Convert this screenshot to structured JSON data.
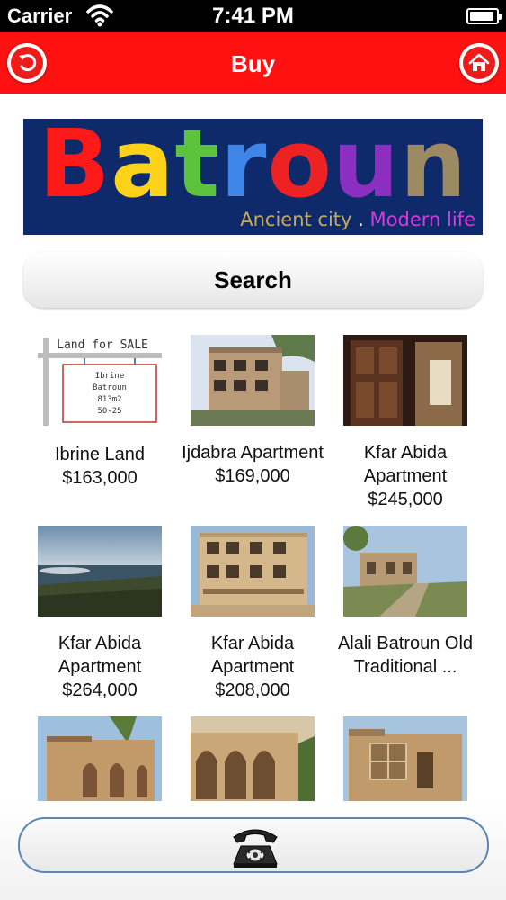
{
  "status_bar": {
    "carrier": "Carrier",
    "time": "7:41 PM",
    "battery_level": 0.95
  },
  "nav": {
    "title": "Buy",
    "back_icon": "back-arrow-icon",
    "home_icon": "home-icon"
  },
  "banner": {
    "title_letters": [
      {
        "char": "B",
        "color": "#ff1a1a"
      },
      {
        "char": "a",
        "color": "#ffd21a"
      },
      {
        "char": "t",
        "color": "#5cc33a"
      },
      {
        "char": "r",
        "color": "#3f86e8"
      },
      {
        "char": "o",
        "color": "#ee2222"
      },
      {
        "char": "u",
        "color": "#8b2fc0"
      },
      {
        "char": "n",
        "color": "#9c8a62"
      }
    ],
    "tagline_part1": "Ancient city",
    "tagline_separator": ".",
    "tagline_part2": "Modern life"
  },
  "search": {
    "label": "Search"
  },
  "listings": [
    {
      "name": "Ibrine Land",
      "price": "$163,000"
    },
    {
      "name": "Ijdabra Apartment",
      "price": "$169,000"
    },
    {
      "name": "Kfar Abida Apartment",
      "price": "$245,000"
    },
    {
      "name": "Kfar Abida Apartment",
      "price": "$264,000"
    },
    {
      "name": "Kfar Abida Apartment",
      "price": "$208,000"
    },
    {
      "name": "Alali Batroun Old Traditional ...",
      "price": ""
    },
    {
      "name": "",
      "price": ""
    },
    {
      "name": "",
      "price": ""
    },
    {
      "name": "",
      "price": ""
    }
  ],
  "land_sign": {
    "header": "Land for SALE",
    "lines": [
      "Ibrine",
      "Batroun",
      "813m2",
      "50-25"
    ]
  },
  "bottom_bar": {
    "call_icon": "telephone-icon"
  }
}
